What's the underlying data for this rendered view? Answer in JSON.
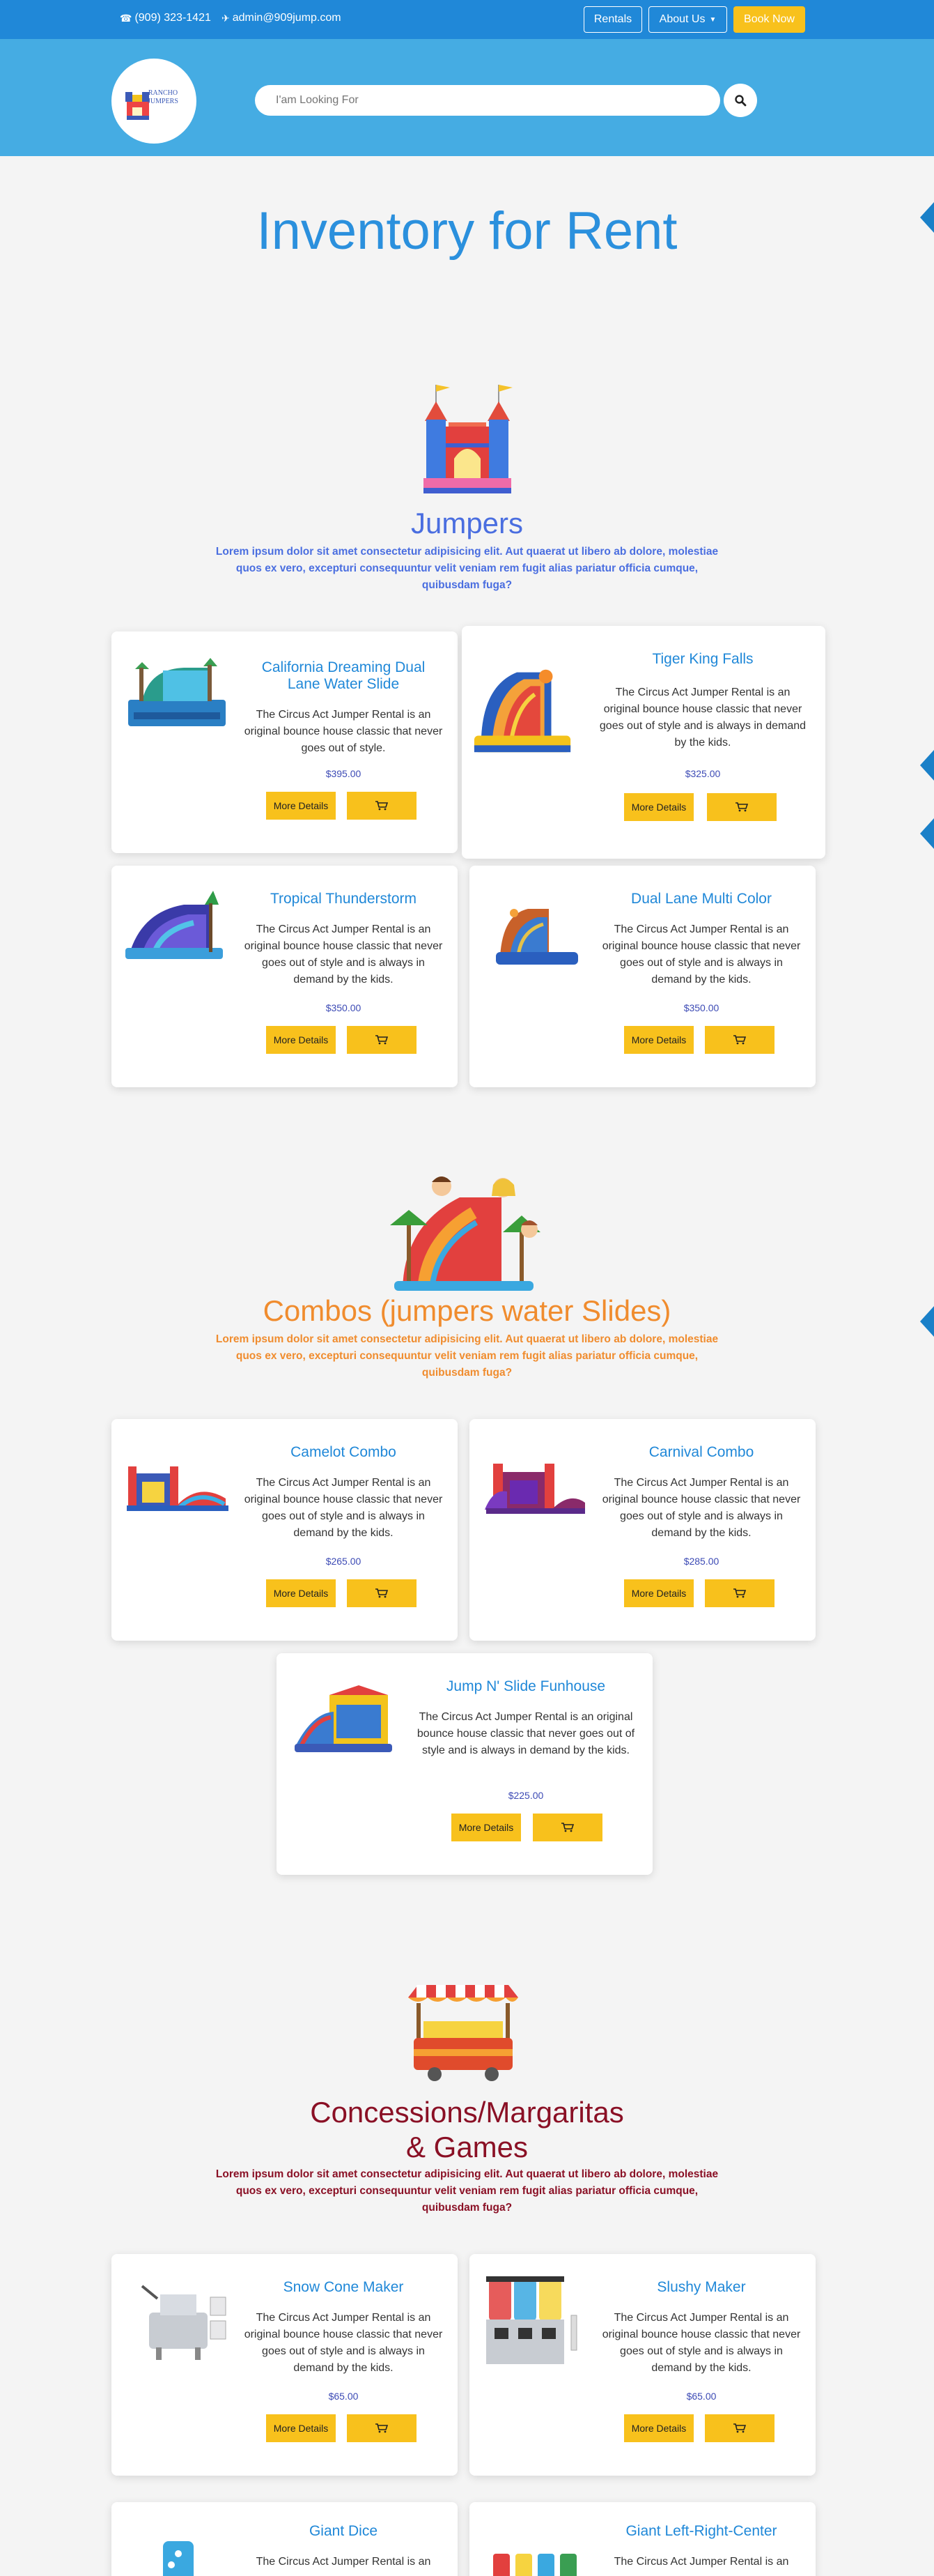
{
  "topbar": {
    "phone": "(909) 323-1421",
    "email": "admin@909jump.com",
    "rentals_label": "Rentals",
    "about_label": "About Us",
    "book_label": "Book Now"
  },
  "header": {
    "logo_line1": "RANCHO",
    "logo_line2": "JUMPERS",
    "search_placeholder": "I'am Looking For"
  },
  "page_title": "Inventory for Rent",
  "sections": [
    {
      "title": "Jumpers",
      "title_color": "#4a6ee0",
      "description": "Lorem ipsum dolor sit amet consectetur adipisicing elit. Aut quaerat ut libero ab dolore, molestiae quos ex vero, excepturi consequuntur velit veniam rem fugit alias pariatur officia cumque, quibusdam fuga?",
      "items": [
        {
          "name": "California Dreaming Dual Lane Water Slide",
          "description": "The Circus Act Jumper Rental is an original bounce house classic that never goes out of style.",
          "price": "$395.00",
          "more_label": "More Details"
        },
        {
          "name": "Tiger King Falls",
          "description": "The Circus Act Jumper Rental is an original bounce house classic that never goes out of style and is always in demand by the kids.",
          "price": "$325.00",
          "more_label": "More Details"
        },
        {
          "name": "Tropical Thunderstorm",
          "description": "The Circus Act Jumper Rental is an original bounce house classic that never goes out of style and is always in demand by the kids.",
          "price": "$350.00",
          "more_label": "More Details"
        },
        {
          "name": "Dual Lane Multi Color",
          "description": "The Circus Act Jumper Rental is an original bounce house classic that never goes out of style and is always in demand by the kids.",
          "price": "$350.00",
          "more_label": "More Details"
        }
      ]
    },
    {
      "title": "Combos (jumpers water Slides)",
      "title_color": "#f08c2e",
      "description": "Lorem ipsum dolor sit amet consectetur adipisicing elit. Aut quaerat ut libero ab dolore, molestiae quos ex vero, excepturi consequuntur velit veniam rem fugit alias pariatur officia cumque, quibusdam fuga?",
      "items": [
        {
          "name": "Camelot Combo",
          "description": "The Circus Act Jumper Rental is an original bounce house classic that never goes out of style and is always in demand by the kids.",
          "price": "$265.00",
          "more_label": "More Details"
        },
        {
          "name": "Carnival Combo",
          "description": "The Circus Act Jumper Rental is an original bounce house classic that never goes out of style and is always in demand by the kids.",
          "price": "$285.00",
          "more_label": "More Details"
        },
        {
          "name": "Jump N' Slide Funhouse",
          "description": "The Circus Act Jumper Rental is an original bounce house classic that never goes out of style and is always in demand by the kids.",
          "price": "$225.00",
          "more_label": "More Details"
        }
      ]
    },
    {
      "title_line1": "Concessions/Margaritas",
      "title_line2": "& Games",
      "title_color": "#8a1025",
      "description": "Lorem ipsum dolor sit amet consectetur adipisicing elit. Aut quaerat ut libero ab dolore, molestiae quos ex vero, excepturi consequuntur velit veniam rem fugit alias pariatur officia cumque, quibusdam fuga?",
      "items": [
        {
          "name": "Snow Cone Maker",
          "description": "The Circus Act Jumper Rental is an original bounce house classic that never goes out of style and is always in demand by the kids.",
          "price": "$65.00",
          "more_label": "More Details"
        },
        {
          "name": "Slushy Maker",
          "description": "The Circus Act Jumper Rental is an original bounce house classic that never goes out of style and is always in demand by the kids.",
          "price": "$65.00",
          "more_label": "More Details"
        },
        {
          "name": "Giant Dice",
          "description": "The Circus Act Jumper Rental is an"
        },
        {
          "name": "Giant Left-Right-Center",
          "description": "The Circus Act Jumper Rental is an"
        }
      ]
    }
  ],
  "colors": {
    "topbar": "#2088d8",
    "header": "#45ace3",
    "accent_yellow": "#f8c11c",
    "title_blue": "#2b90dd",
    "product_name": "#2088d8",
    "price": "#3d4bb5"
  }
}
